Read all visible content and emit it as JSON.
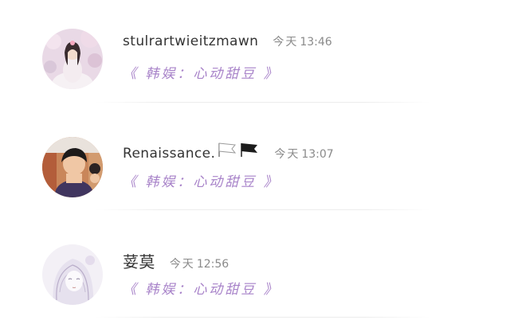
{
  "entries": [
    {
      "username": "stulrartwieitzmawn",
      "time_label": "今天",
      "time": "13:46",
      "group": "《 韩娱：心动甜豆 》",
      "avatar_icon": "girl-in-floral-garden-avatar"
    },
    {
      "username": "Renaissance.",
      "flags": [
        "white-flag-icon",
        "black-flag-icon"
      ],
      "time_label": "今天",
      "time": "13:07",
      "group": "《 韩娱：心动甜豆 》",
      "avatar_icon": "boy-selfie-avatar"
    },
    {
      "username": "荽莫",
      "time_label": "今天",
      "time": "12:56",
      "group": "《 韩娱：心动甜豆 》",
      "avatar_icon": "anime-sketch-girl-avatar"
    }
  ],
  "colors": {
    "link": "#a883c9",
    "meta": "#8a8a8a",
    "name": "#333333"
  }
}
